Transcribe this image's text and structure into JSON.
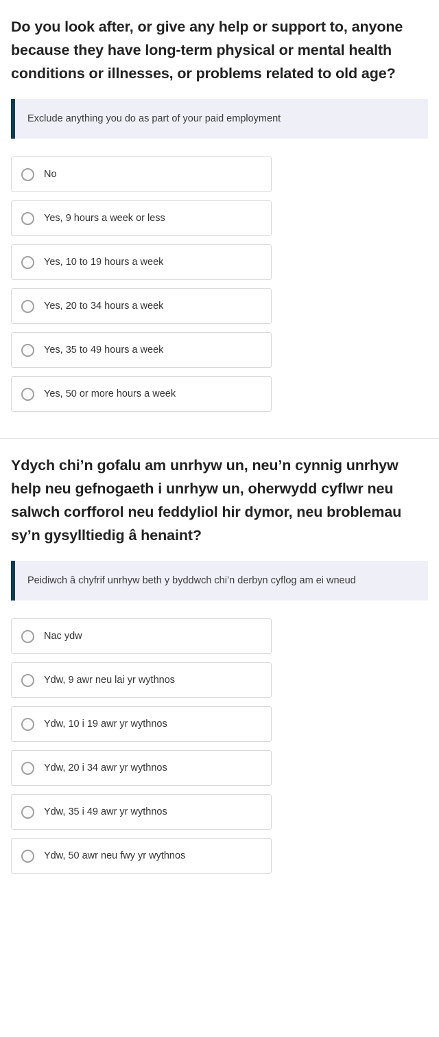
{
  "colors": {
    "hint_background": "#eeeff7",
    "hint_bar": "#0b3b52",
    "option_border": "#d9d9d9",
    "radio_border": "#a0a0a0",
    "heading_text": "#222222",
    "divider": "#d6d8dc",
    "page_background": "#ffffff"
  },
  "questions": [
    {
      "language": "en",
      "heading": "Do you look after, or give any help or support to, anyone because they have long-term physical or mental health conditions or illnesses, or problems related to old age?",
      "hint": "Exclude anything you do as part of your paid employment",
      "options": [
        {
          "label": "No",
          "selected": false
        },
        {
          "label": "Yes, 9 hours a week or less",
          "selected": false
        },
        {
          "label": "Yes, 10 to 19 hours a week",
          "selected": false
        },
        {
          "label": "Yes, 20 to 34 hours a week",
          "selected": false
        },
        {
          "label": "Yes, 35 to 49 hours a week",
          "selected": false
        },
        {
          "label": "Yes, 50 or more hours a week",
          "selected": false
        }
      ]
    },
    {
      "language": "cy",
      "heading": "Ydych chi’n gofalu am unrhyw un, neu’n cynnig unrhyw help neu gefnogaeth i unrhyw un, oherwydd cyflwr neu salwch corfforol neu feddyliol hir dymor, neu broblemau sy’n gysylltiedig â henaint?",
      "hint": "Peidiwch â chyfrif unrhyw beth y byddwch chi’n derbyn cyflog am ei wneud",
      "options": [
        {
          "label": "Nac ydw",
          "selected": false
        },
        {
          "label": "Ydw, 9 awr neu lai yr wythnos",
          "selected": false
        },
        {
          "label": "Ydw, 10 i 19 awr yr wythnos",
          "selected": false
        },
        {
          "label": "Ydw, 20 i 34 awr yr wythnos",
          "selected": false
        },
        {
          "label": "Ydw, 35 i 49 awr yr wythnos",
          "selected": false
        },
        {
          "label": "Ydw, 50 awr neu fwy yr wythnos",
          "selected": false
        }
      ]
    }
  ]
}
